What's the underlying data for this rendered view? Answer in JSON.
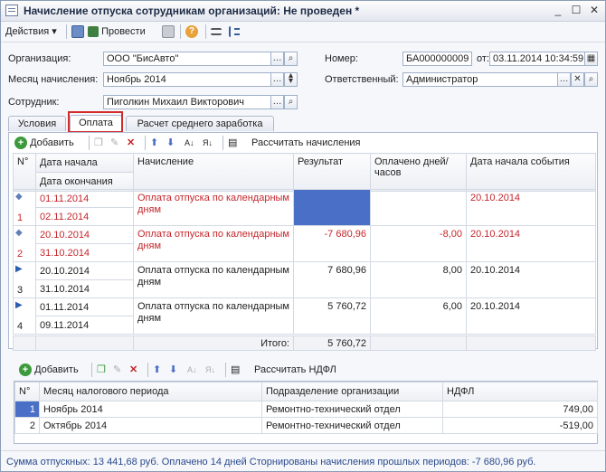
{
  "window": {
    "title": "Начисление отпуска сотрудникам организаций: Не проведен *"
  },
  "toolbar": {
    "actions_label": "Действия",
    "post_label": "Провести"
  },
  "form": {
    "organization_label": "Организация:",
    "organization_value": "ООО \"БисАвто\"",
    "number_label": "Номер:",
    "number_value": "БА000000009",
    "date_label": "от:",
    "date_value": "03.11.2014 10:34:59",
    "month_label": "Месяц начисления:",
    "month_value": "Ноябрь 2014",
    "responsible_label": "Ответственный:",
    "responsible_value": "Администратор",
    "employee_label": "Сотрудник:",
    "employee_value": "Пиголкин Михаил Викторович"
  },
  "tabs": [
    {
      "label": "Условия"
    },
    {
      "label": "Оплата"
    },
    {
      "label": "Расчет среднего заработка"
    }
  ],
  "payment": {
    "add_label": "Добавить",
    "calc_label": "Рассчитать начисления",
    "headers": {
      "n": "N°",
      "start": "Дата начала",
      "end": "Дата окончания",
      "accrual": "Начисление",
      "result": "Результат",
      "paid": "Оплачено дней/часов",
      "event": "Дата начала события"
    },
    "rows": [
      {
        "n": "1",
        "start": "01.11.2014",
        "end": "02.11.2014",
        "accrual": "Оплата отпуска по календарным дням",
        "result": "",
        "paid": "",
        "event": "20.10.2014",
        "red": true
      },
      {
        "n": "2",
        "start": "20.10.2014",
        "end": "31.10.2014",
        "accrual": "Оплата отпуска по календарным дням",
        "result": "-7 680,96",
        "paid": "-8,00",
        "event": "20.10.2014",
        "red": true
      },
      {
        "n": "3",
        "start": "20.10.2014",
        "end": "31.10.2014",
        "accrual": "Оплата отпуска по календарным дням",
        "result": "7 680,96",
        "paid": "8,00",
        "event": "20.10.2014",
        "red": false
      },
      {
        "n": "4",
        "start": "01.11.2014",
        "end": "09.11.2014",
        "accrual": "Оплата отпуска по календарным дням",
        "result": "5 760,72",
        "paid": "6,00",
        "event": "20.10.2014",
        "red": false
      }
    ],
    "total_label": "Итого:",
    "total_value": "5 760,72"
  },
  "ndfl": {
    "add_label": "Добавить",
    "calc_label": "Рассчитать НДФЛ",
    "headers": {
      "n": "N°",
      "period": "Месяц налогового периода",
      "dept": "Подразделение организации",
      "tax": "НДФЛ"
    },
    "rows": [
      {
        "n": "1",
        "period": "Ноябрь 2014",
        "dept": "Ремонтно-технический отдел",
        "tax": "749,00"
      },
      {
        "n": "2",
        "period": "Октябрь 2014",
        "dept": "Ремонтно-технический отдел",
        "tax": "-519,00"
      }
    ]
  },
  "footer": {
    "text": "Сумма отпускных: 13 441,68 руб. Оплачено 14 дней Сторнированы начисления прошлых периодов: -7 680,96 руб."
  }
}
